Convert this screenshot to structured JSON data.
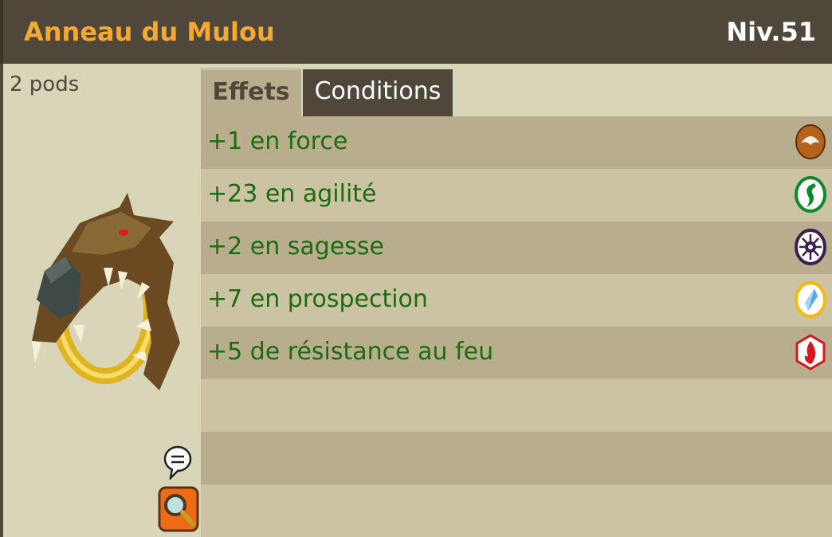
{
  "header": {
    "title": "Anneau du Mulou",
    "level": "Niv.51"
  },
  "item": {
    "weight": "2 pods"
  },
  "tabs": [
    {
      "label": "Effets",
      "active": true
    },
    {
      "label": "Conditions",
      "active": false
    }
  ],
  "effects": [
    {
      "text": "+1 en force",
      "icon": "force-icon",
      "color": "#b4621c"
    },
    {
      "text": "+23 en agilité",
      "icon": "agility-icon",
      "color": "#0e8a2a"
    },
    {
      "text": "+2 en sagesse",
      "icon": "wisdom-icon",
      "color": "#3c1f4e"
    },
    {
      "text": "+7 en prospection",
      "icon": "prospecting-icon",
      "color": "#f5b813"
    },
    {
      "text": "+5 de résistance au feu",
      "icon": "fire-resistance-icon",
      "color": "#d4181e"
    }
  ],
  "colors": {
    "header_bg": "#4f473a",
    "title": "#f5a935",
    "effect_text": "#1d6b10",
    "panel_bg": "#d9d5b8",
    "row_dark": "#b8ae8d",
    "row_light": "#cbc3a3"
  }
}
